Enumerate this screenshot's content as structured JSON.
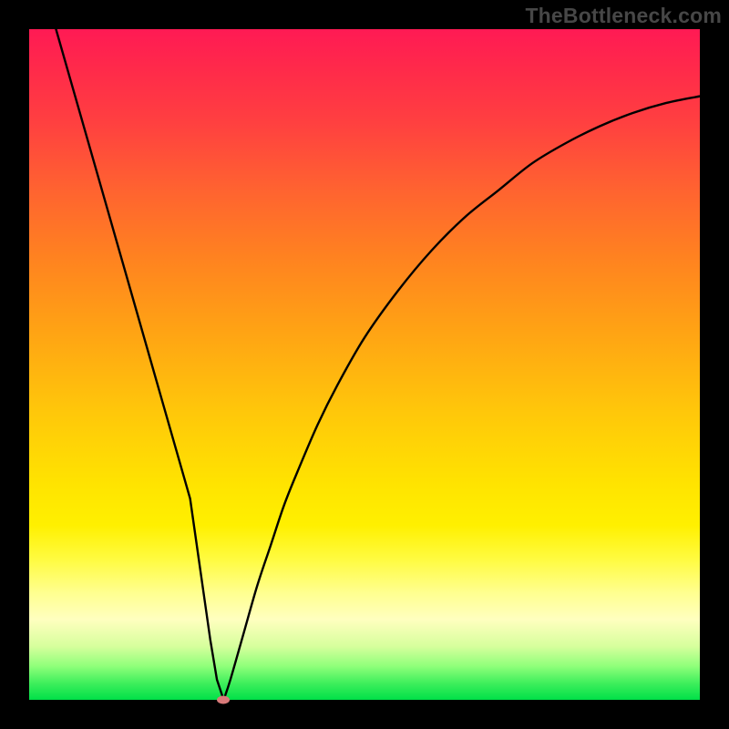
{
  "watermark": "TheBottleneck.com",
  "chart_data": {
    "type": "line",
    "title": "",
    "xlabel": "",
    "ylabel": "",
    "xlim": [
      0,
      100
    ],
    "ylim": [
      0,
      100
    ],
    "grid": false,
    "series": [
      {
        "name": "bottleneck-curve",
        "x": [
          4,
          6,
          8,
          10,
          12,
          14,
          16,
          18,
          20,
          22,
          24,
          26,
          27,
          28,
          29,
          30,
          32,
          34,
          36,
          38,
          40,
          43,
          46,
          50,
          55,
          60,
          65,
          70,
          75,
          80,
          85,
          90,
          95,
          100
        ],
        "values": [
          100,
          93,
          86,
          79,
          72,
          65,
          58,
          51,
          44,
          37,
          30,
          16,
          9,
          3,
          0,
          3,
          10,
          17,
          23,
          29,
          34,
          41,
          47,
          54,
          61,
          67,
          72,
          76,
          80,
          83,
          85.5,
          87.5,
          89,
          90
        ]
      }
    ],
    "annotations": [
      {
        "name": "min-point-marker",
        "x": 29,
        "y": 0,
        "color": "#d97a7a"
      }
    ],
    "background": {
      "type": "vertical-gradient",
      "stops": [
        {
          "pos": 0,
          "color": "#ff1a54"
        },
        {
          "pos": 14,
          "color": "#ff4040"
        },
        {
          "pos": 34,
          "color": "#ff8220"
        },
        {
          "pos": 57,
          "color": "#ffc70a"
        },
        {
          "pos": 74,
          "color": "#fff000"
        },
        {
          "pos": 88,
          "color": "#ffffbf"
        },
        {
          "pos": 100,
          "color": "#00e048"
        }
      ]
    }
  }
}
